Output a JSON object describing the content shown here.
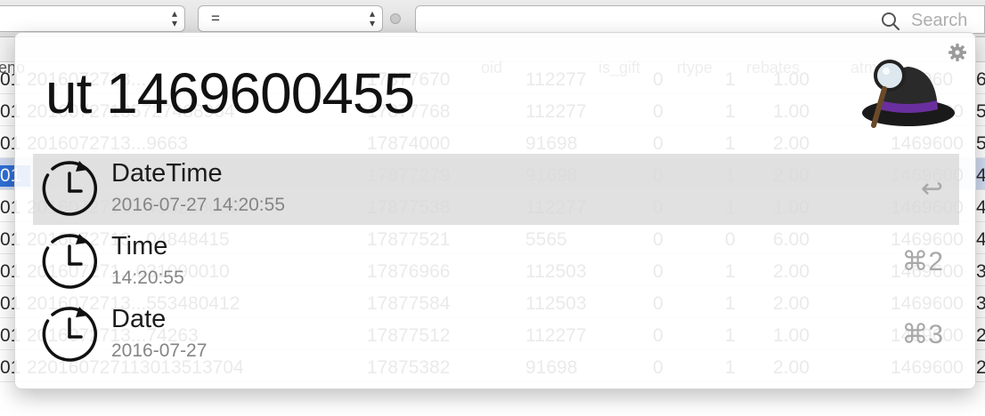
{
  "background_app": {
    "filter_field_value": "",
    "operator_value": "=",
    "search": {
      "placeholder": "Search"
    },
    "grid": {
      "columns": [
        "eno",
        "",
        "oid",
        "is_gift",
        "rtype",
        "rebates",
        "atm"
      ],
      "rows": [
        {
          "c0": "01",
          "c1": "2016072713...",
          "c2": "17877670",
          "c3": "112277",
          "c4": "0",
          "c5": "1",
          "c6": "1.00",
          "c7": "146960",
          "c8": "6"
        },
        {
          "c0": "01",
          "c1": "20160727135727488964",
          "c2": "17877768",
          "c3": "112277",
          "c4": "0",
          "c5": "1",
          "c6": "1.00",
          "c7": "1469600",
          "c8": "5"
        },
        {
          "c0": "01",
          "c1": "2016072713...9663",
          "c2": "17874000",
          "c3": "91698",
          "c4": "0",
          "c5": "1",
          "c6": "2.00",
          "c7": "1469600",
          "c8": "5"
        },
        {
          "c0": "01",
          "c1": "",
          "c2": "17877279",
          "c3": "91698",
          "c4": "0",
          "c5": "1",
          "c6": "2.00",
          "c7": "1469600",
          "c8": "4"
        },
        {
          "c0": "01",
          "c1": "2016072713...433238080",
          "c2": "17877538",
          "c3": "112277",
          "c4": "0",
          "c5": "1",
          "c6": "1.00",
          "c7": "1469600",
          "c8": "4"
        },
        {
          "c0": "01",
          "c1": "2016072713...04848415",
          "c2": "17877521",
          "c3": "5565",
          "c4": "0",
          "c5": "0",
          "c6": "6.00",
          "c7": "1469600",
          "c8": "4"
        },
        {
          "c0": "01",
          "c1": "201607271...031090010",
          "c2": "17876966",
          "c3": "112503",
          "c4": "0",
          "c5": "1",
          "c6": "2.00",
          "c7": "1469600",
          "c8": "3"
        },
        {
          "c0": "01",
          "c1": "2016072713...553480412",
          "c2": "17877584",
          "c3": "112503",
          "c4": "0",
          "c5": "1",
          "c6": "2.00",
          "c7": "1469600",
          "c8": "3"
        },
        {
          "c0": "01",
          "c1": "2016072713...74263",
          "c2": "17877512",
          "c3": "112277",
          "c4": "0",
          "c5": "1",
          "c6": "1.00",
          "c7": "1469600",
          "c8": "2"
        },
        {
          "c0": "01",
          "c1": "22016072711301351370​4",
          "c2": "17875382",
          "c3": "91698",
          "c4": "0",
          "c5": "1",
          "c6": "2.00",
          "c7": "1469600",
          "c8": "2"
        }
      ]
    }
  },
  "alfred": {
    "query": "ut 1469600455",
    "icons": {
      "settings": "gear-icon",
      "logo": "alfred-hat-icon",
      "result": "clock-refresh-icon"
    },
    "results": [
      {
        "title": "DateTime",
        "subtitle": "2016-07-27 14:20:55",
        "shortcut": "↩",
        "selected": true
      },
      {
        "title": "Time",
        "subtitle": "14:20:55",
        "shortcut": "⌘2",
        "selected": false
      },
      {
        "title": "Date",
        "subtitle": "2016-07-27",
        "shortcut": "⌘3",
        "selected": false
      }
    ]
  },
  "colors": {
    "selection_blue": "#2f6fd6",
    "result_highlight": "#d7d7d7",
    "hat_band": "#6a2f9e"
  }
}
